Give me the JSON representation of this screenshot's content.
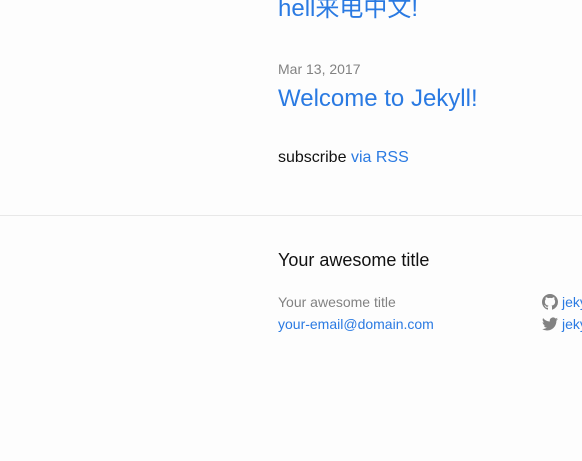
{
  "posts": {
    "top_title": "hell来电中文!",
    "items": [
      {
        "date": "Mar 13, 2017",
        "title": "Welcome to Jekyll!"
      }
    ]
  },
  "rss": {
    "label": "subscribe",
    "link_text": "via RSS"
  },
  "footer": {
    "heading": "Your awesome title",
    "site_name": "Your awesome title",
    "email": "your-email@domain.com",
    "social": [
      {
        "icon": "github-icon",
        "handle": "jekyll"
      },
      {
        "icon": "twitter-icon",
        "handle": "jekyllrb"
      }
    ]
  },
  "colors": {
    "link": "#2a7ae2",
    "meta": "#828282",
    "text": "#111111",
    "rule": "#e8e8e8",
    "background": "#fdfdfd"
  }
}
